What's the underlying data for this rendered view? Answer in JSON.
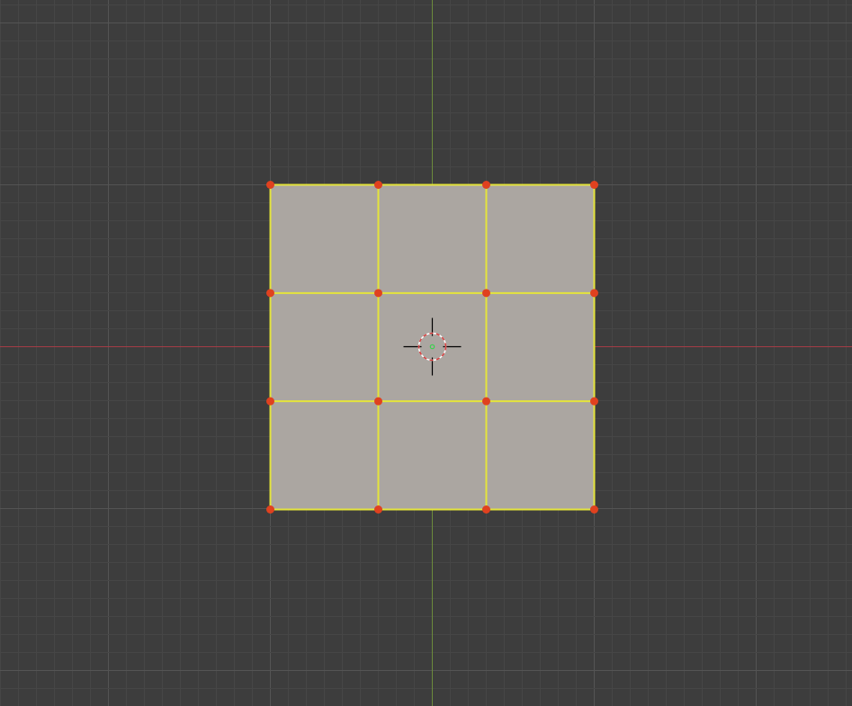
{
  "viewport": {
    "view": "top-orthographic",
    "mode": "edit-mode",
    "select_mode": "vertex",
    "background_color": "#3d3d3d",
    "grid": {
      "visible": true,
      "minor_color": "#464646",
      "major_color": "#545454"
    },
    "axes": {
      "x_axis_color": "#a33c45",
      "y_axis_color": "#6c8a3c"
    }
  },
  "mesh": {
    "object": "plane",
    "subdivisions": 3,
    "grid_size": [
      4,
      4
    ],
    "face_color": "#aba6a1",
    "selected_edge_color": "#e4e43c",
    "selected_vertex_color": "#e0411f",
    "all_selected": true
  },
  "overlays": {
    "cursor_3d": {
      "icon": "3d-cursor-icon",
      "ring_colors": [
        "#d94040",
        "#ffffff"
      ],
      "crosshair_color": "#000000"
    },
    "origin": {
      "icon": "object-origin-icon",
      "color": "#3cd04e"
    }
  }
}
